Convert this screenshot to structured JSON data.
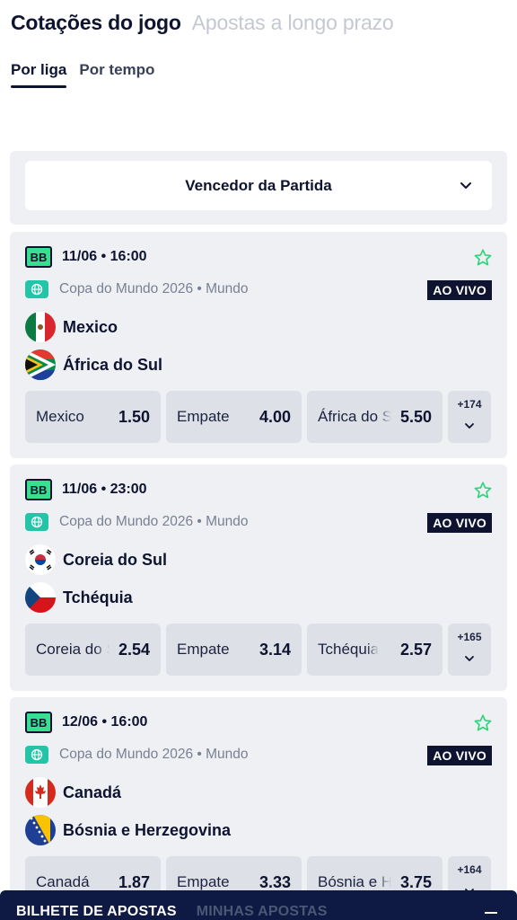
{
  "header": {
    "tabs": [
      {
        "label": "Cotações do jogo",
        "active": true
      },
      {
        "label": "Apostas a longo prazo",
        "active": false
      }
    ],
    "sub_tabs": [
      {
        "label": "Por liga",
        "active": true
      },
      {
        "label": "Por tempo",
        "active": false
      }
    ]
  },
  "market": {
    "label": "Vencedor da Partida",
    "icon": "chevron-down-icon"
  },
  "matches": [
    {
      "badge": "BB",
      "datetime": "11/06 • 16:00",
      "league": "Copa do Mundo 2026 • Mundo",
      "live_label": "AO VIVO",
      "home": "Mexico",
      "away": "África do Sul",
      "odds": [
        {
          "label": "Mexico",
          "value": "1.50"
        },
        {
          "label": "Empate",
          "value": "4.00"
        },
        {
          "label": "África do Sul",
          "value": "5.50"
        }
      ],
      "more": "+174"
    },
    {
      "badge": "BB",
      "datetime": "11/06 • 23:00",
      "league": "Copa do Mundo 2026 • Mundo",
      "live_label": "AO VIVO",
      "home": "Coreia do Sul",
      "away": "Tchéquia",
      "odds": [
        {
          "label": "Coreia do Sul",
          "value": "2.54"
        },
        {
          "label": "Empate",
          "value": "3.14"
        },
        {
          "label": "Tchéquia",
          "value": "2.57"
        }
      ],
      "more": "+165"
    },
    {
      "badge": "BB",
      "datetime": "12/06 • 16:00",
      "league": "Copa do Mundo 2026 • Mundo",
      "live_label": "AO VIVO",
      "home": "Canadá",
      "away": "Bósnia e Herzegovina",
      "odds": [
        {
          "label": "Canadá",
          "value": "1.87"
        },
        {
          "label": "Empate",
          "value": "3.33"
        },
        {
          "label": "Bósnia e Herzegovina",
          "value": "3.75"
        }
      ],
      "more": "+164"
    }
  ],
  "bottom_bar": {
    "tabs": [
      {
        "label": "BILHETE DE APOSTAS",
        "active": true
      },
      {
        "label": "MINHAS APOSTAS",
        "active": false
      }
    ],
    "collapse_icon": "minus-icon"
  },
  "colors": {
    "navy": "#0e1430",
    "badge_green": "#36e08f",
    "star_green": "#2ed47a",
    "globe_teal": "#23c4a8",
    "card_bg": "#eef0f3",
    "odd_bg": "#dde0e6"
  }
}
